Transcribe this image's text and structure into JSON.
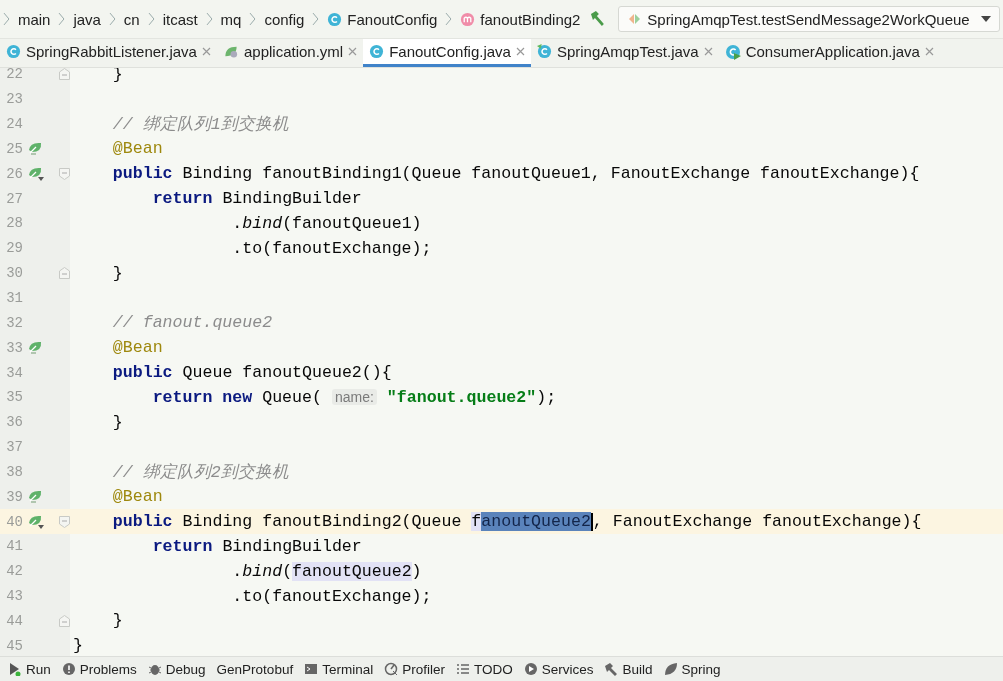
{
  "breadcrumbs": [
    "main",
    "java",
    "cn",
    "itcast",
    "mq",
    "config",
    "FanoutConfig",
    "fanoutBinding2"
  ],
  "run_config": {
    "label": "SpringAmqpTest.testSendMessage2WorkQueue"
  },
  "tabs": [
    {
      "label": "SpringRabbitListener.java",
      "selected": false
    },
    {
      "label": "application.yml",
      "selected": false
    },
    {
      "label": "FanoutConfig.java",
      "selected": true
    },
    {
      "label": "SpringAmqpTest.java",
      "selected": false
    },
    {
      "label": "ConsumerApplication.java",
      "selected": false
    }
  ],
  "editor": {
    "lines": [
      {
        "number": "22",
        "fold_marker": {
          "kind": "end"
        },
        "current": false,
        "tokens": [
          {
            "kind": "plain",
            "text": "    }"
          }
        ]
      },
      {
        "number": "23",
        "current": false
      },
      {
        "number": "24",
        "current": false,
        "tokens": [
          {
            "kind": "comment",
            "text": "    // 绑定队列1到交换机"
          }
        ]
      },
      {
        "number": "25",
        "gutter_icon": {
          "kind": "bean"
        },
        "current": false,
        "tokens": [
          {
            "kind": "annotation",
            "text": "    @Bean"
          }
        ]
      },
      {
        "number": "26",
        "gutter_icon": {
          "kind": "bean-link"
        },
        "fold_marker": {
          "kind": "start"
        },
        "current": false,
        "tokens": [
          {
            "kind": "keyword",
            "text": "    public"
          },
          {
            "kind": "plain",
            "text": " Binding fanoutBinding1(Queue fanoutQueue1, FanoutExchange fanoutExchange){"
          }
        ]
      },
      {
        "number": "27",
        "current": false,
        "tokens": [
          {
            "kind": "keyword",
            "text": "        return"
          },
          {
            "kind": "plain",
            "text": " BindingBuilder"
          }
        ]
      },
      {
        "number": "28",
        "current": false,
        "tokens": [
          {
            "kind": "plain",
            "text": "                ."
          },
          {
            "kind": "call",
            "text": "bind"
          },
          {
            "kind": "plain",
            "text": "(fanoutQueue1)"
          }
        ]
      },
      {
        "number": "29",
        "current": false,
        "tokens": [
          {
            "kind": "plain",
            "text": "                .to(fanoutExchange);"
          }
        ]
      },
      {
        "number": "30",
        "fold_marker": {
          "kind": "end"
        },
        "current": false,
        "tokens": [
          {
            "kind": "plain",
            "text": "    }"
          }
        ]
      },
      {
        "number": "31",
        "current": false
      },
      {
        "number": "32",
        "current": false,
        "tokens": [
          {
            "kind": "comment",
            "text": "    // fanout.queue2"
          }
        ]
      },
      {
        "number": "33",
        "gutter_icon": {
          "kind": "bean"
        },
        "current": false,
        "tokens": [
          {
            "kind": "annotation",
            "text": "    @Bean"
          }
        ]
      },
      {
        "number": "34",
        "current": false,
        "tokens": [
          {
            "kind": "keyword",
            "text": "    public"
          },
          {
            "kind": "plain",
            "text": " Queue fanoutQueue2(){"
          }
        ]
      },
      {
        "number": "35",
        "current": false,
        "tokens": [
          {
            "kind": "keyword",
            "text": "        return new"
          },
          {
            "kind": "plain",
            "text": " Queue( "
          },
          {
            "kind": "hint",
            "text": "name:"
          },
          {
            "kind": "string",
            "text": "\"fanout.queue2\""
          },
          {
            "kind": "plain",
            "text": ");"
          }
        ]
      },
      {
        "number": "36",
        "current": false,
        "tokens": [
          {
            "kind": "plain",
            "text": "    }"
          }
        ]
      },
      {
        "number": "37",
        "current": false
      },
      {
        "number": "38",
        "current": false,
        "tokens": [
          {
            "kind": "comment",
            "text": "    // 绑定队列2到交换机"
          }
        ]
      },
      {
        "number": "39",
        "gutter_icon": {
          "kind": "bean"
        },
        "current": false,
        "tokens": [
          {
            "kind": "annotation",
            "text": "    @Bean"
          }
        ]
      },
      {
        "number": "40",
        "gutter_icon": {
          "kind": "bean-link"
        },
        "fold_marker": {
          "kind": "start"
        },
        "current": true,
        "tokens": [
          {
            "kind": "keyword",
            "text": "    public"
          },
          {
            "kind": "plain",
            "text": " Binding fanoutBinding2(Queue "
          },
          {
            "kind": "usage",
            "text": "f"
          },
          {
            "kind": "selection",
            "text": "anoutQueue2"
          },
          {
            "kind": "caret"
          },
          {
            "kind": "plain",
            "text": ", FanoutExchange fanoutExchange){"
          }
        ]
      },
      {
        "number": "41",
        "current": false,
        "tokens": [
          {
            "kind": "keyword",
            "text": "        return"
          },
          {
            "kind": "plain",
            "text": " BindingBuilder"
          }
        ]
      },
      {
        "number": "42",
        "current": false,
        "tokens": [
          {
            "kind": "plain",
            "text": "                ."
          },
          {
            "kind": "call",
            "text": "bind"
          },
          {
            "kind": "plain",
            "text": "("
          },
          {
            "kind": "usage",
            "text": "fanoutQueue2"
          },
          {
            "kind": "plain",
            "text": ")"
          }
        ]
      },
      {
        "number": "43",
        "current": false,
        "tokens": [
          {
            "kind": "plain",
            "text": "                .to(fanoutExchange);"
          }
        ]
      },
      {
        "number": "44",
        "fold_marker": {
          "kind": "end"
        },
        "current": false,
        "tokens": [
          {
            "kind": "plain",
            "text": "    }"
          }
        ]
      },
      {
        "number": "45",
        "current": false,
        "tokens": [
          {
            "kind": "plain",
            "text": "}"
          }
        ]
      }
    ]
  },
  "tool_windows": [
    "Run",
    "Problems",
    "Debug",
    "GenProtobuf",
    "Terminal",
    "Profiler",
    "TODO",
    "Services",
    "Build",
    "Spring"
  ]
}
